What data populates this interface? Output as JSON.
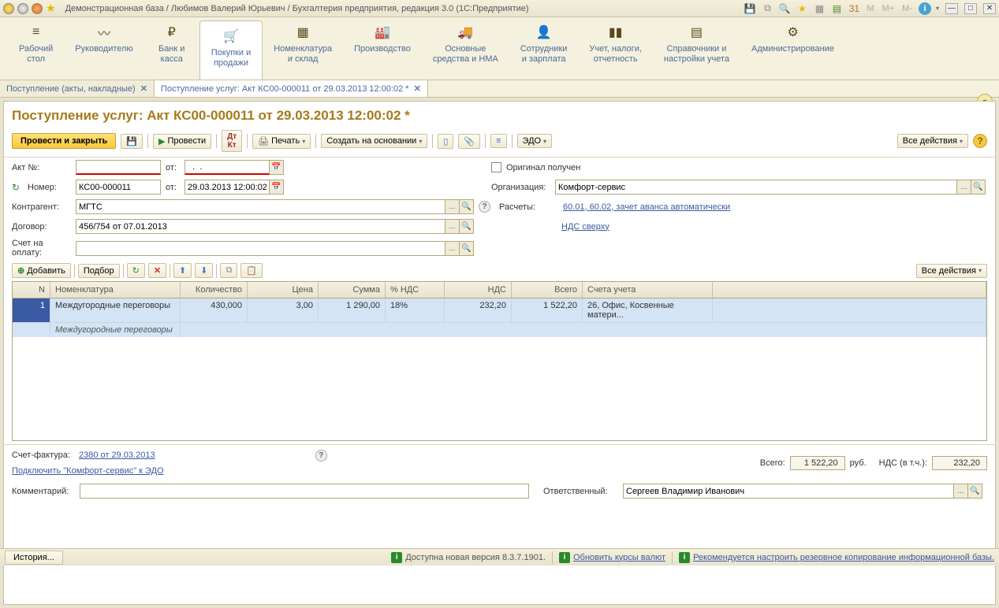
{
  "titlebar": {
    "title": "Демонстрационная база / Любимов Валерий Юрьевич / Бухгалтерия предприятия, редакция 3.0  (1С:Предприятие)",
    "m": "M",
    "mplus": "M+",
    "mminus": "M-"
  },
  "ribbon": [
    {
      "label": "Рабочий\nстол",
      "icon": "≡"
    },
    {
      "label": "Руководителю",
      "icon": "〰"
    },
    {
      "label": "Банк и\nкасса",
      "icon": "₽"
    },
    {
      "label": "Покупки и\nпродажи",
      "icon": "🛒"
    },
    {
      "label": "Номенклатура\nи склад",
      "icon": "▦"
    },
    {
      "label": "Производство",
      "icon": "🏭"
    },
    {
      "label": "Основные\nсредства и НМА",
      "icon": "🚚"
    },
    {
      "label": "Сотрудники\nи зарплата",
      "icon": "👤"
    },
    {
      "label": "Учет, налоги,\nотчетность",
      "icon": "▮▮"
    },
    {
      "label": "Справочники и\nнастройки учета",
      "icon": "▤"
    },
    {
      "label": "Администрирование",
      "icon": "⚙"
    }
  ],
  "tabs": [
    {
      "label": "Поступление (акты, накладные)"
    },
    {
      "label": "Поступление услуг: Акт КС00-000011 от 29.03.2013 12:00:02 *"
    }
  ],
  "page": {
    "title": "Поступление услуг: Акт КС00-000011 от 29.03.2013 12:00:02 *",
    "btn_primary": "Провести и закрыть",
    "btn_provesti": "Провести",
    "btn_pechat": "Печать",
    "btn_sozdat": "Создать на основании",
    "btn_edo": "ЭДО",
    "btn_all": "Все действия"
  },
  "form": {
    "akt_label": "Акт №:",
    "ot_label": "от:",
    "akt_date": "  .  .    ",
    "nomer_label": "Номер:",
    "nomer": "КС00-000011",
    "nomer_date": "29.03.2013 12:00:02",
    "original_label": "Оригинал получен",
    "org_label": "Организация:",
    "org": "Комфорт-сервис",
    "kontragent_label": "Контрагент:",
    "kontragent": "МГТС",
    "raschety_label": "Расчеты:",
    "raschety_link": "60.01, 60.02, зачет аванса автоматически",
    "dogovor_label": "Договор:",
    "dogovor": "456/754 от 07.01.2013",
    "nds_link": "НДС сверху",
    "schet_label": "Счет на оплату:",
    "schet": ""
  },
  "grid_toolbar": {
    "add": "Добавить",
    "podbor": "Подбор",
    "all": "Все действия"
  },
  "grid": {
    "headers": {
      "n": "N",
      "nom": "Номенклатура",
      "qty": "Количество",
      "price": "Цена",
      "sum": "Сумма",
      "vat": "% НДС",
      "vatamt": "НДС",
      "total": "Всего",
      "acct": "Счета учета"
    },
    "row": {
      "n": "1",
      "nom": "Междугородные переговоры",
      "nom2": "Междугородные переговоры",
      "qty": "430,000",
      "price": "3,00",
      "sum": "1 290,00",
      "vat": "18%",
      "vatamt": "232,20",
      "total": "1 522,20",
      "acct": "26, Офис, Косвенные матери..."
    }
  },
  "footer": {
    "sf_label": "Счет-фактура:",
    "sf_link": "2380 от 29.03.2013",
    "edo_link": "Подключить \"Комфорт-сервис\" к ЭДО",
    "vsego_label": "Всего:",
    "vsego": "1 522,20",
    "rub": "руб.",
    "nds_label": "НДС (в т.ч.):",
    "nds": "232,20",
    "comment_label": "Комментарий:",
    "resp_label": "Ответственный:",
    "resp": "Сергеев Владимир Иванович"
  },
  "status": {
    "history": "История...",
    "s1": "Доступна новая версия 8.3.7.1901.",
    "s2": "Обновить курсы валют",
    "s3": "Рекомендуется настроить резервное копирование информационной базы."
  }
}
